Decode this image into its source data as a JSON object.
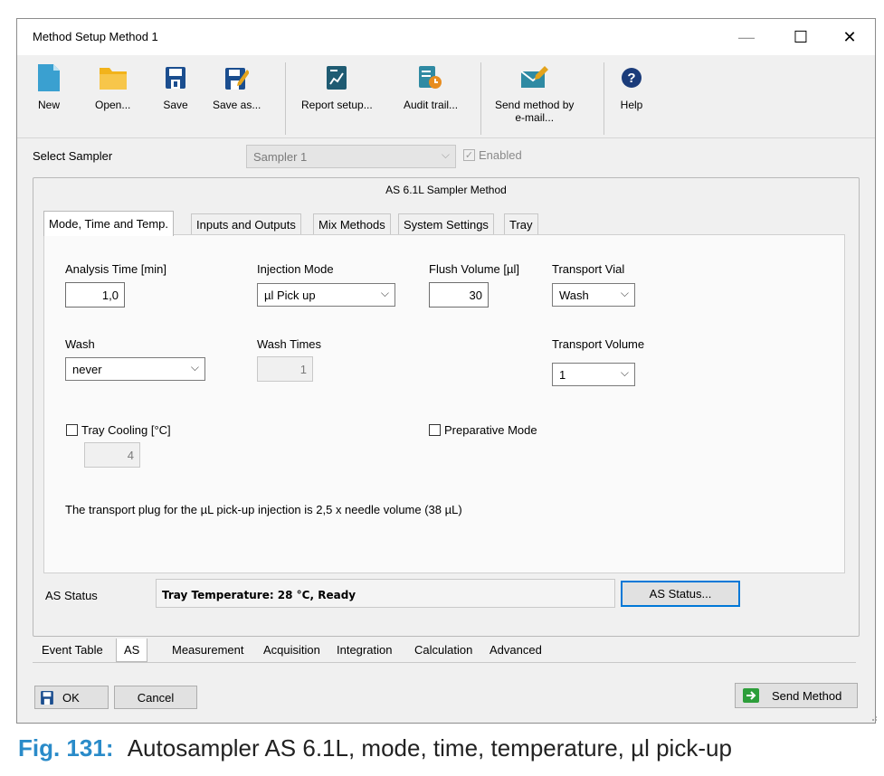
{
  "window": {
    "title": "Method Setup Method 1",
    "min_glyph": "—",
    "max_glyph": "☐",
    "close_glyph": "✕"
  },
  "toolbar": {
    "new": "New",
    "open": "Open...",
    "save": "Save",
    "save_as": "Save as...",
    "report_setup": "Report setup...",
    "audit_trail": "Audit trail...",
    "send_email_line1": "Send method by",
    "send_email_line2": "e-mail...",
    "help": "Help"
  },
  "sampler": {
    "label": "Select Sampler",
    "value": "Sampler 1",
    "enabled_label": "Enabled",
    "enabled_checked": true
  },
  "group_title": "AS 6.1L Sampler Method",
  "tabs": [
    "Mode, Time and Temp.",
    "Inputs and Outputs",
    "Mix Methods",
    "System Settings",
    "Tray"
  ],
  "fields": {
    "analysis_time_label": "Analysis Time [min]",
    "analysis_time_value": "1,0",
    "injection_mode_label": "Injection Mode",
    "injection_mode_value": "µl Pick up",
    "flush_volume_label": "Flush Volume [µl]",
    "flush_volume_value": "30",
    "transport_vial_label": "Transport Vial",
    "transport_vial_value": "Wash",
    "wash_label": "Wash",
    "wash_value": "never",
    "wash_times_label": "Wash Times",
    "wash_times_value": "1",
    "transport_volume_label": "Transport Volume",
    "transport_volume_value": "1",
    "tray_cooling_label": "Tray Cooling [°C]",
    "tray_cooling_value": "4",
    "preparative_label": "Preparative Mode"
  },
  "note": "The transport plug for the µL pick-up injection is 2,5 x needle volume (38 µL)",
  "status": {
    "label": "AS Status",
    "text": "Tray Temperature: 28 °C, Ready",
    "button": "AS Status..."
  },
  "bottom_tabs": [
    "Event Table",
    "AS",
    "Measurement",
    "Acquisition",
    "Integration",
    "Calculation",
    "Advanced"
  ],
  "buttons": {
    "ok": "OK",
    "cancel": "Cancel",
    "send_method": "Send Method"
  },
  "caption": {
    "fig": "Fig. 131:",
    "text": "Autosampler AS 6.1L, mode, time, temperature, µl pick-up"
  },
  "colors": {
    "accent": "#0078d7",
    "caption_fig": "#2a8bc9"
  }
}
